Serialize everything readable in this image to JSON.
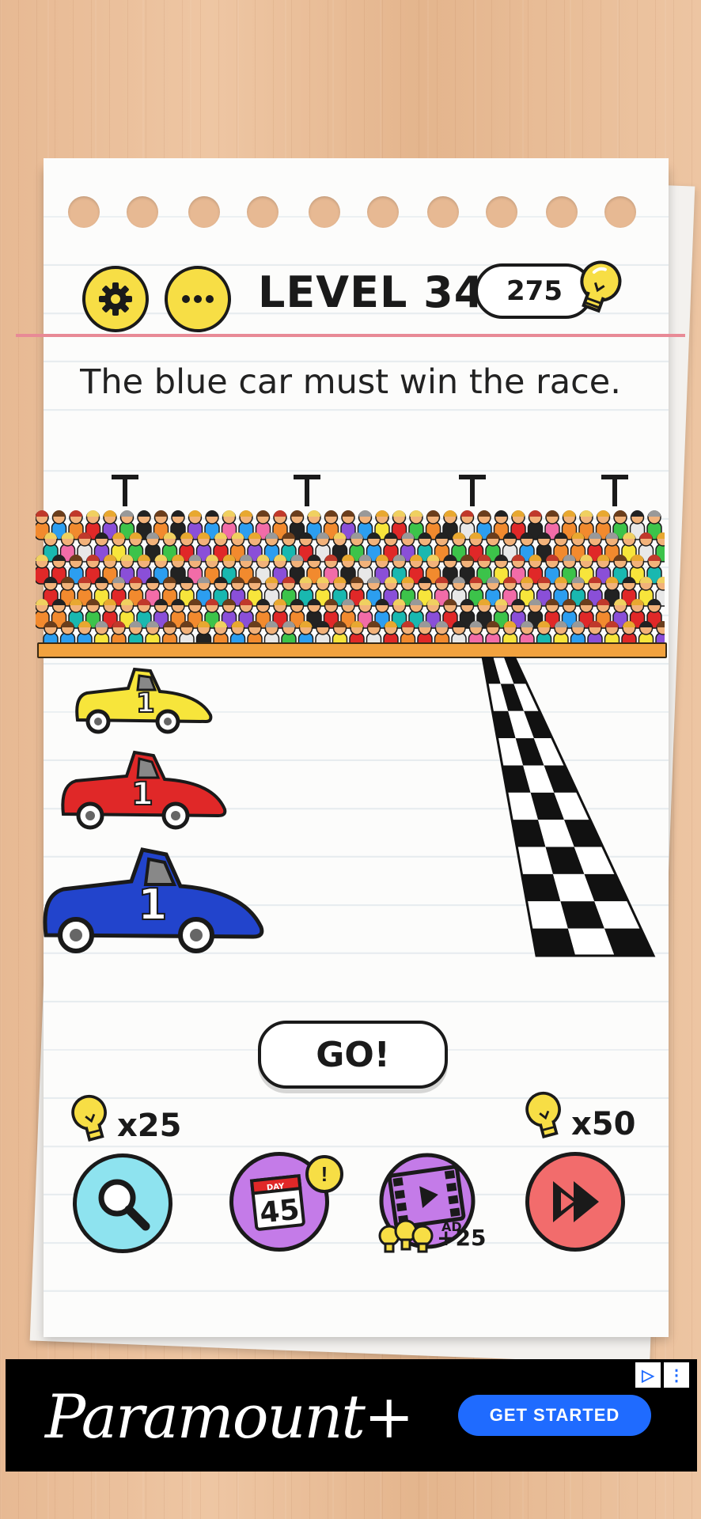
{
  "header": {
    "level_label": "LEVEL 346",
    "hint_count": "275",
    "icons": [
      "gear-icon",
      "more-icon",
      "lightbulb-icon"
    ]
  },
  "instruction": "The blue car must win the race.",
  "cars": [
    {
      "color": "yellow",
      "number": "1",
      "hex": "#f7e53b"
    },
    {
      "color": "red",
      "number": "1",
      "hex": "#e02828"
    },
    {
      "color": "blue",
      "number": "1",
      "hex": "#2244cc"
    }
  ],
  "go_button": {
    "label": "GO!"
  },
  "hints": {
    "search": {
      "cost": "x25",
      "icon": "magnifier-icon",
      "color": "#8ee3ef"
    },
    "daily": {
      "day_label": "DAY",
      "day_number": "45",
      "badge": "!",
      "icon": "calendar-icon",
      "color": "#c47be8"
    },
    "ad": {
      "label": "AD",
      "reward": "+25",
      "icon": "video-icon",
      "color": "#c47be8"
    },
    "skip": {
      "cost": "x50",
      "icon": "fast-forward-icon",
      "color": "#f26c6c"
    }
  },
  "ad_banner": {
    "brand": "Paramount+",
    "cta": "GET STARTED",
    "colors": {
      "background": "#000000",
      "cta": "#1f6bff"
    }
  },
  "colors": {
    "accent_yellow": "#f7de45",
    "margin_line": "#e88a96",
    "ledge": "#f2a23e"
  }
}
